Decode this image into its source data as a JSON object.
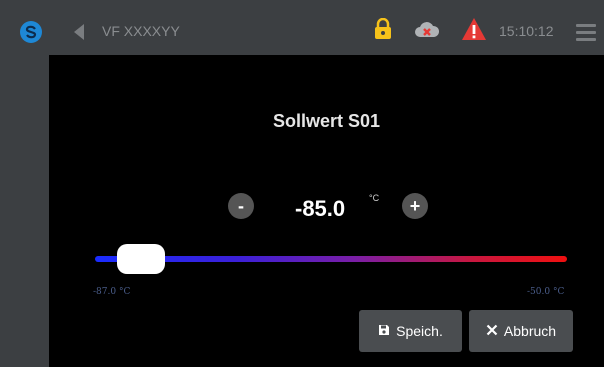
{
  "header": {
    "title": "VF XXXXYY",
    "time": "15:10:12",
    "icons": [
      "logo-icon",
      "back-icon",
      "lock-icon",
      "cloud-error-icon",
      "warning-icon",
      "menu-icon"
    ]
  },
  "dialog": {
    "title": "Sollwert S01",
    "minus_label": "-",
    "plus_label": "+",
    "value": "-85.0",
    "unit": "°C",
    "slider": {
      "min_label": "-87.0 °C",
      "max_label": "-50.0 °C",
      "min": -87.0,
      "max": -50.0,
      "value": -85.0
    },
    "save_label": "Speich.",
    "cancel_label": "Abbruch"
  },
  "colors": {
    "accent_blue": "#1e88d6",
    "lock_yellow": "#f6c21a",
    "warning_red": "#e53935",
    "gradient_start": "#1a2cff",
    "gradient_end": "#f01010"
  }
}
